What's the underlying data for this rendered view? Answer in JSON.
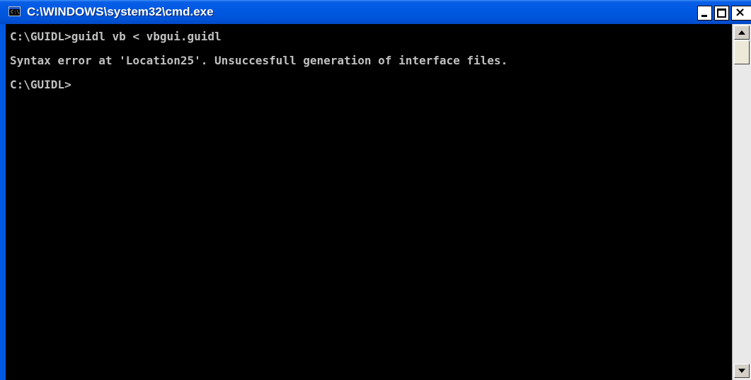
{
  "window": {
    "title": "C:\\WINDOWS\\system32\\cmd.exe",
    "icon_text": "C:\\",
    "controls": {
      "minimize_icon": "minimize-icon",
      "maximize_icon": "maximize-icon",
      "close_icon": "close-icon",
      "close_glyph": "×"
    }
  },
  "console": {
    "lines": [
      "C:\\GUIDL>guidl vb < vbgui.guidl",
      "Syntax error at 'Location25'. Unsuccesfull generation of interface files.",
      "C:\\GUIDL>"
    ],
    "colors": {
      "background": "#000000",
      "text": "#c0c0c0"
    }
  },
  "scrollbar": {
    "up_icon": "scroll-up-arrow-icon",
    "down_icon": "scroll-down-arrow-icon"
  },
  "theme": {
    "titlebar": "#0058e2",
    "titlebar_text": "#ffffff"
  }
}
